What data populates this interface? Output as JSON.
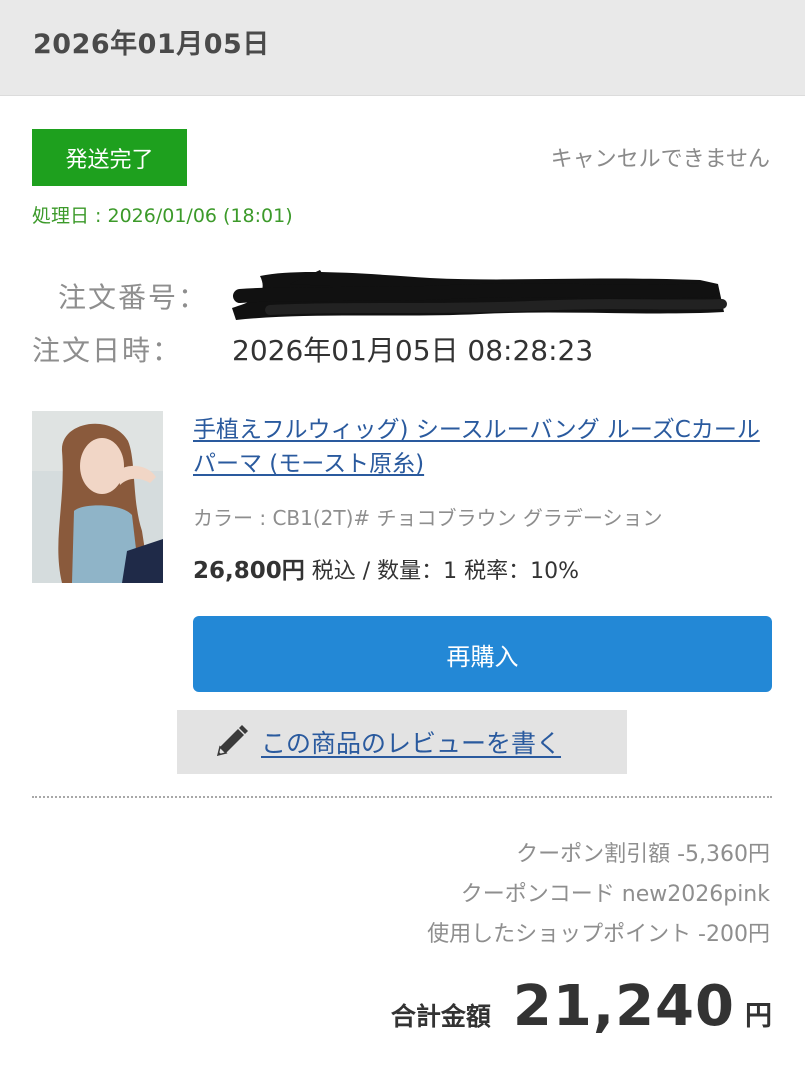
{
  "header": {
    "date": "2026年01月05日"
  },
  "order": {
    "status_badge": "発送完了",
    "cancel_note": "キャンセルできません",
    "processed": "処理日 : 2026/01/06 (18:01)",
    "order_number_label": "注文番号：",
    "order_date_label": "注文日時：",
    "order_date_value": "2026年01月05日 08:28:23"
  },
  "item": {
    "title": "手植えフルウィッグ) シースルーバング ルーズCカールパーマ (モースト原糸)",
    "variant": "カラー : CB1(2T)# チョコブラウン グラデーション",
    "price": "26,800円",
    "price_suffix": "税込 / 数量：1 税率：10%",
    "rebuy_label": "再購入",
    "review_label": "この商品のレビューを書く"
  },
  "summary": {
    "coupon_discount": "クーポン割引額 -5,360円",
    "coupon_code": "クーポンコード new2026pink",
    "shop_points": "使用したショップポイント -200円",
    "total_label": "合計金額",
    "total_amount": "21,240",
    "total_unit": "円"
  },
  "colors": {
    "status_green": "#1ea01e",
    "processed_green": "#3c9a2a",
    "link_blue": "#2a5a9e",
    "button_blue": "#2388d6"
  },
  "icons": {
    "review": "pencil-icon",
    "product_image": "product-thumbnail"
  }
}
